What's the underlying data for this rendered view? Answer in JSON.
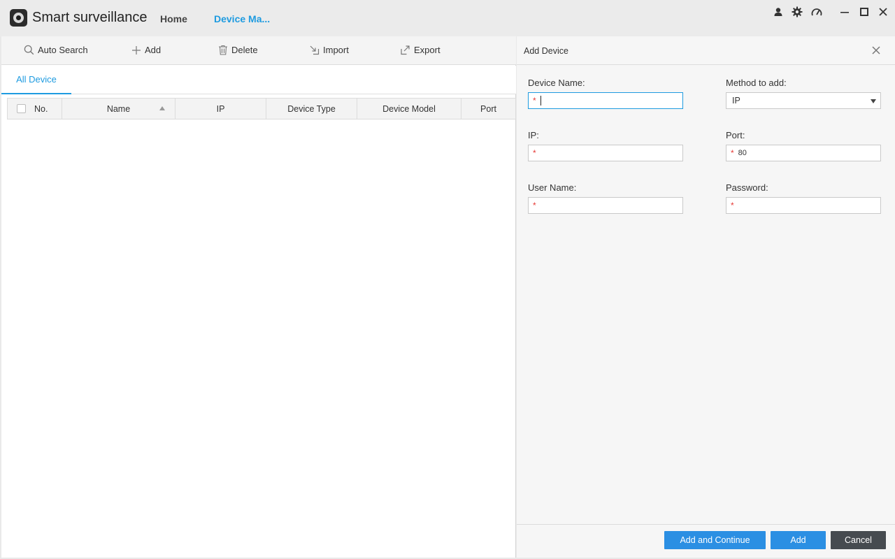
{
  "app": {
    "title": "Smart surveillance"
  },
  "nav": {
    "home": "Home",
    "device_manager": "Device Ma..."
  },
  "toolbar": {
    "auto_search": "Auto Search",
    "add": "Add",
    "delete": "Delete",
    "import": "Import",
    "export": "Export"
  },
  "subtab": {
    "all_device": "All Device"
  },
  "table": {
    "columns": [
      "No.",
      "Name",
      "IP",
      "Device Type",
      "Device Model",
      "Port"
    ],
    "rows": []
  },
  "add_device": {
    "title": "Add Device",
    "device_name": {
      "label": "Device Name:",
      "value": ""
    },
    "method": {
      "label": "Method to add:",
      "value": "IP"
    },
    "ip": {
      "label": "IP:",
      "value": ""
    },
    "port": {
      "label": "Port:",
      "value": "80"
    },
    "user_name": {
      "label": "User Name:",
      "value": ""
    },
    "password": {
      "label": "Password:",
      "value": ""
    },
    "required_mark": "*",
    "buttons": {
      "add_continue": "Add and Continue",
      "add": "Add",
      "cancel": "Cancel"
    }
  },
  "colors": {
    "accent": "#1e9be0",
    "button_primary": "#2b8fe3",
    "button_cancel": "#464b50",
    "required": "#e53935"
  }
}
